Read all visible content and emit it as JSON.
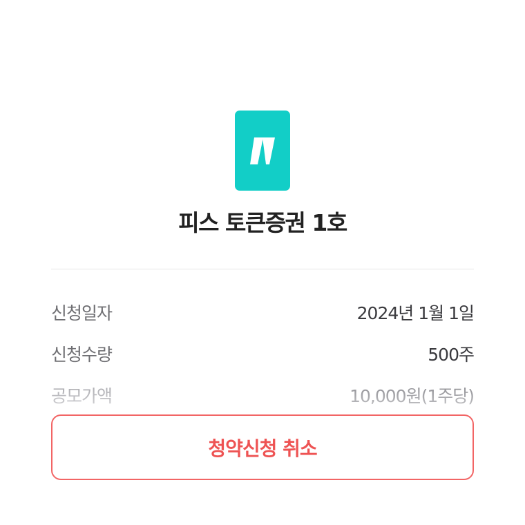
{
  "product": {
    "logo_icon": "brand-logo-icon",
    "logo_color": "#12cec7",
    "title": "피스 토큰증권 1호"
  },
  "details": [
    {
      "label": "신청일자",
      "value": "2024년 1월 1일"
    },
    {
      "label": "신청수량",
      "value": "500주"
    },
    {
      "label": "공모가액",
      "value": "10,000원(1주당)"
    }
  ],
  "actions": {
    "cancel_label": "청약신청 취소",
    "cancel_color": "#ee5353"
  }
}
